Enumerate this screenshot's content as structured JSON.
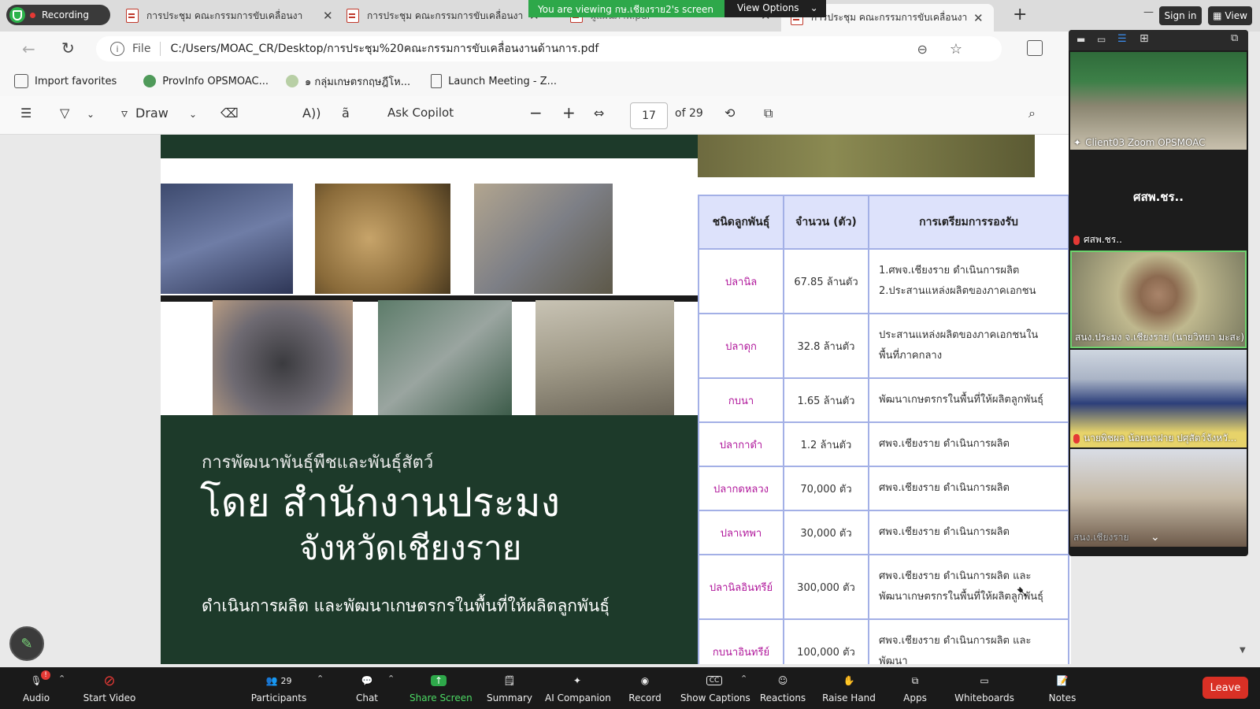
{
  "recording": {
    "label": "Recording"
  },
  "tabs": [
    {
      "title": "การประชุม คณะกรรมการขับเคลื่อนงา",
      "close": "✕"
    },
    {
      "title": "การประชุม คณะกรรมการขับเคลื่อนงา",
      "close": "✕"
    },
    {
      "title": "ผู้แผนภาพ.pdf",
      "close": "✕"
    },
    {
      "title": "การประชุม คณะกรรมการขับเคลื่อนงา",
      "close": "✕"
    }
  ],
  "new_tab": "+",
  "share_banner": {
    "text": "You are viewing กษ.เชียงราย2's screen",
    "options": "View Options"
  },
  "window": {
    "minimize": "—",
    "signin": "Sign in",
    "view": "View"
  },
  "address": {
    "scheme": "File",
    "url": "C:/Users/MOAC_CR/Desktop/การประชุม%20คณะกรรมการขับเคลื่อนงานด้านการ.pdf"
  },
  "bookmarks": [
    {
      "label": "Import favorites"
    },
    {
      "label": "ProvInfo OPSMOAC..."
    },
    {
      "label": "๑ กลุ่มเกษตรกฤษฎีโห..."
    },
    {
      "label": "Launch Meeting - Z..."
    }
  ],
  "pdf_toolbar": {
    "draw": "Draw",
    "copilot": "Ask Copilot",
    "page": "17",
    "of": "of 29"
  },
  "slide": {
    "subtitle": "การพัฒนาพันธุ์พืชและพันธุ์สัตว์",
    "title1": "โดย สำนักงานประมง",
    "title2": "จังหวัดเชียงราย",
    "tagline": "ดำเนินการผลิต และพัฒนาเกษตรกรในพื้นที่ให้ผลิตลูกพันธุ์"
  },
  "table": {
    "headers": [
      "ชนิดลูกพันธุ์",
      "จำนวน (ตัว)",
      "การเตรียมการรองรับ"
    ],
    "rows": [
      {
        "kind": "ปลานิล",
        "qty": "67.85 ล้านตัว",
        "prep": "1.ศพจ.เชียงราย ดำเนินการผลิต 2.ประสานแหล่งผลิตของภาคเอกชน"
      },
      {
        "kind": "ปลาดุก",
        "qty": "32.8 ล้านตัว",
        "prep": "ประสานแหล่งผลิตของภาคเอกชนในพื้นที่ภาคกลาง"
      },
      {
        "kind": "กบนา",
        "qty": "1.65 ล้านตัว",
        "prep": "พัฒนาเกษตรกรในพื้นที่ให้ผลิตลูกพันธุ์"
      },
      {
        "kind": "ปลากาดำ",
        "qty": "1.2 ล้านตัว",
        "prep": "ศพจ.เชียงราย ดำเนินการผลิต"
      },
      {
        "kind": "ปลากดหลวง",
        "qty": "70,000 ตัว",
        "prep": "ศพจ.เชียงราย ดำเนินการผลิต"
      },
      {
        "kind": "ปลาเทพา",
        "qty": "30,000 ตัว",
        "prep": "ศพจ.เชียงราย ดำเนินการผลิต"
      },
      {
        "kind": "ปลานิลอินทรีย์",
        "qty": "300,000 ตัว",
        "prep": "ศพจ.เชียงราย ดำเนินการผลิต และพัฒนาเกษตรกรในพื้นที่ให้ผลิตลูกพันธุ์"
      },
      {
        "kind": "กบนาอินทรีย์",
        "qty": "100,000 ตัว",
        "prep": "ศพจ.เชียงราย ดำเนินการผลิต และพัฒนา"
      }
    ]
  },
  "participants_panel": [
    {
      "name": "Client03 Zoom OPSMOAC"
    },
    {
      "name": "ศสพ.ชร..",
      "big": "ศสพ.ชร.."
    },
    {
      "name": "สนง.ประมง จ.เชียงราย (นายวิทยา มะสะ)"
    },
    {
      "name": "นายพิชผล น้อยนาฝาย ปศุสัตว์จังหวั..."
    },
    {
      "name": "สนง.เชียงราย"
    }
  ],
  "zoom_toolbar": {
    "audio": "Audio",
    "audio_badge": "!",
    "video": "Start Video",
    "participants": "Participants",
    "participants_count": "29",
    "chat": "Chat",
    "share": "Share Screen",
    "summary": "Summary",
    "companion": "AI Companion",
    "record": "Record",
    "captions": "Show Captions",
    "reactions": "Reactions",
    "raise": "Raise Hand",
    "apps": "Apps",
    "whiteboards": "Whiteboards",
    "notes": "Notes",
    "leave": "Leave"
  },
  "colors": {
    "slide_green": "#1d3a2a",
    "table_border": "#a3b0e6",
    "table_header": "#dde2fb",
    "kind_text": "#b0179b",
    "share_green": "#2ea84a",
    "leave_red": "#d93025"
  }
}
